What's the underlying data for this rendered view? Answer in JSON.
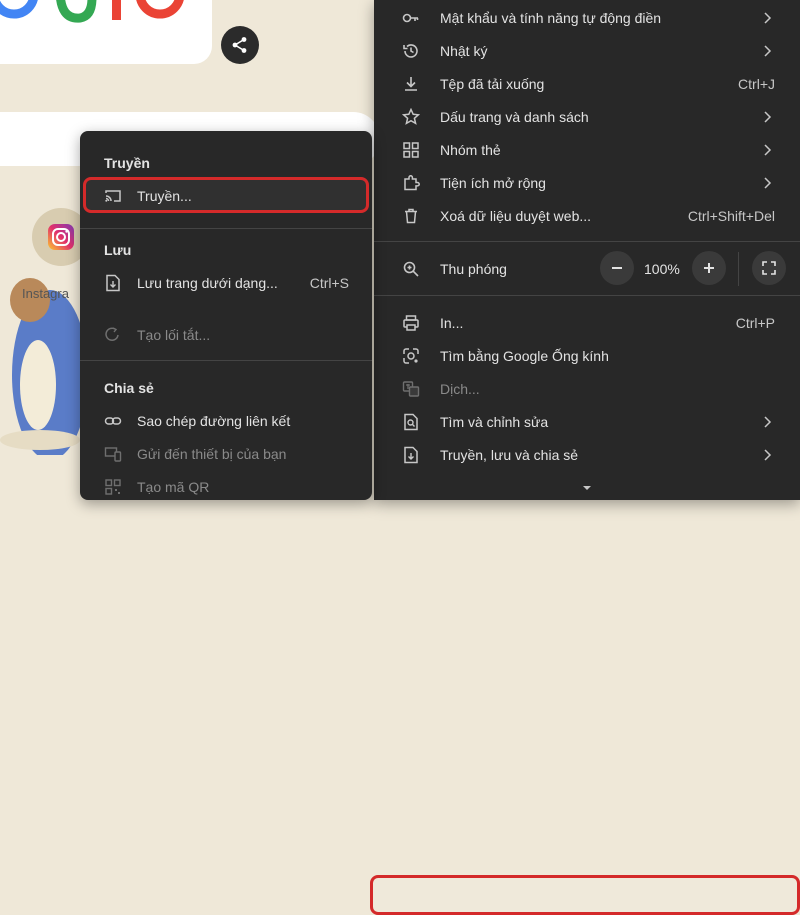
{
  "background": {
    "insta_label": "Instagra"
  },
  "main_menu": {
    "items": [
      {
        "label": "Mật khẩu và tính năng tự động điền",
        "icon": "key-icon"
      },
      {
        "label": "Nhật ký",
        "icon": "history-icon"
      },
      {
        "label": "Tệp đã tải xuống",
        "shortcut": "Ctrl+J",
        "icon": "download-icon"
      },
      {
        "label": "Dấu trang và danh sách",
        "icon": "star-icon"
      },
      {
        "label": "Nhóm thẻ",
        "icon": "tab-groups-icon"
      },
      {
        "label": "Tiện ích mở rộng",
        "icon": "extension-icon"
      },
      {
        "label": "Xoá dữ liệu duyệt web...",
        "shortcut": "Ctrl+Shift+Del",
        "icon": "trash-icon"
      }
    ],
    "zoom": {
      "label": "Thu phóng",
      "minus": "−",
      "plus": "+",
      "value": "100%"
    },
    "items2": [
      {
        "label": "In...",
        "shortcut": "Ctrl+P",
        "icon": "print-icon"
      },
      {
        "label": "Tìm bằng Google Ống kính",
        "icon": "google-lens-icon"
      },
      {
        "label": "Dịch...",
        "icon": "translate-icon",
        "disabled": true
      },
      {
        "label": "Tìm và chỉnh sửa",
        "icon": "find-edit-icon"
      },
      {
        "label": "Truyền, lưu và chia sẻ",
        "icon": "cast-save-share-icon",
        "highlighted": true
      }
    ]
  },
  "sub_menu": {
    "sections": [
      {
        "heading": "Truyền",
        "items": [
          {
            "label": "Truyền...",
            "icon": "cast-icon",
            "highlighted": true
          }
        ]
      },
      {
        "heading": "Lưu",
        "items": [
          {
            "label": "Lưu trang dưới dạng...",
            "shortcut": "Ctrl+S",
            "icon": "save-page-icon"
          },
          {
            "label": "Tạo lối tắt...",
            "icon": "shortcut-icon",
            "disabled": true
          }
        ]
      },
      {
        "heading": "Chia sẻ",
        "items": [
          {
            "label": "Sao chép đường liên kết",
            "icon": "link-icon"
          },
          {
            "label": "Gửi đến thiết bị của bạn",
            "icon": "send-device-icon",
            "disabled": true
          },
          {
            "label": "Tạo mã QR",
            "icon": "qr-code-icon",
            "disabled": true
          }
        ]
      }
    ]
  },
  "colors": {
    "menu_bg": "#282828",
    "highlight_border": "#d42a2a",
    "page_bg": "#efe8d8"
  }
}
